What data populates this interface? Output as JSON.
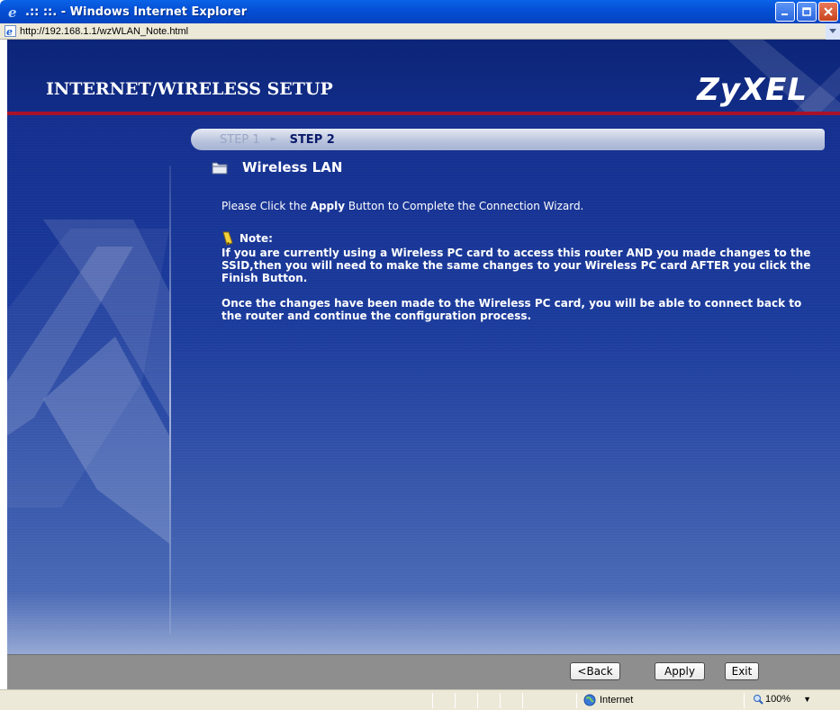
{
  "window": {
    "title": ".:: ::. - Windows Internet Explorer",
    "url": "http://192.168.1.1/wzWLAN_Note.html"
  },
  "header": {
    "title": "INTERNET/WIRELESS SETUP",
    "brand": "ZyXEL"
  },
  "steps": {
    "step1": "STEP 1",
    "step2": "STEP 2"
  },
  "section": {
    "title": "Wireless LAN"
  },
  "instruction": {
    "before": "Please Click the ",
    "bold": "Apply",
    "after": " Button to Complete the Connection Wizard."
  },
  "note": {
    "label": "Note:",
    "para1": "If you are currently using a Wireless PC card to access this router AND you made changes to the SSID,then you will need to make the same changes to your Wireless PC card AFTER you click the Finish Button.",
    "para2": "Once the changes have been made to the Wireless PC card, you will be able to connect back to the router and continue the configuration process."
  },
  "buttons": {
    "back": "<Back",
    "apply": "Apply",
    "exit": "Exit"
  },
  "statusbar": {
    "zone": "Internet",
    "zoom": "100%"
  },
  "colors": {
    "page_bg": "#1e3ea0",
    "header_bg": "#0c2578",
    "accent_red": "#a8122a",
    "titlebar": "#0550d6"
  }
}
